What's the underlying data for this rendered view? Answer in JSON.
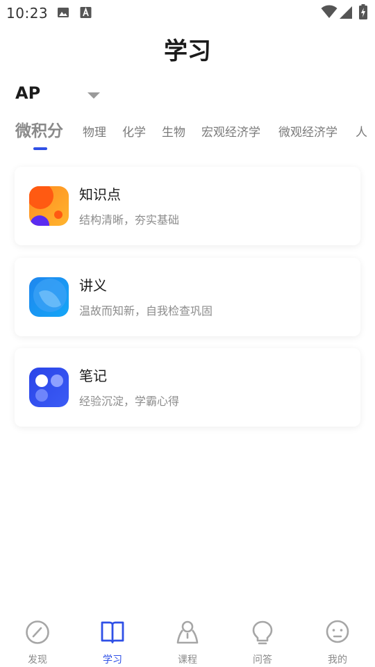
{
  "status_bar": {
    "time": "10:23",
    "left_icons": [
      "image-icon",
      "font-download-icon"
    ],
    "right_icons": [
      "wifi-icon",
      "cell-signal-icon",
      "battery-charging-icon"
    ]
  },
  "header": {
    "title": "学习"
  },
  "exam_selector": {
    "value": "AP",
    "icon": "chevron-down-icon"
  },
  "tabs": [
    {
      "label": "微积分",
      "active": true
    },
    {
      "label": "物理",
      "active": false
    },
    {
      "label": "化学",
      "active": false
    },
    {
      "label": "生物",
      "active": false
    },
    {
      "label": "宏观经济学",
      "active": false
    },
    {
      "label": "微观经济学",
      "active": false
    },
    {
      "label": "人",
      "active": false
    }
  ],
  "cards": [
    {
      "title": "知识点",
      "subtitle": "结构清晰，夯实基础",
      "icon": "knowledge-points-icon"
    },
    {
      "title": "讲义",
      "subtitle": "温故而知新，自我检查巩固",
      "icon": "handout-icon"
    },
    {
      "title": "笔记",
      "subtitle": "经验沉淀，学霸心得",
      "icon": "notes-icon"
    }
  ],
  "bottom_nav": [
    {
      "label": "发现",
      "icon": "compass-icon",
      "active": false
    },
    {
      "label": "学习",
      "icon": "book-icon",
      "active": true
    },
    {
      "label": "课程",
      "icon": "course-icon",
      "active": false
    },
    {
      "label": "问答",
      "icon": "lightbulb-icon",
      "active": false
    },
    {
      "label": "我的",
      "icon": "profile-icon",
      "active": false
    }
  ],
  "colors": {
    "accent": "#2f50e6",
    "text_primary": "#1b1b1b",
    "text_secondary": "#8c8c8c",
    "inactive": "#8a8a8a"
  }
}
